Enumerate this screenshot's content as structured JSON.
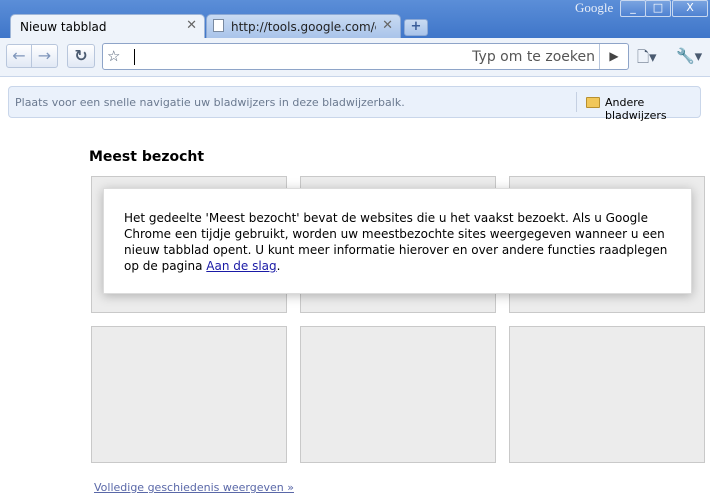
{
  "window": {
    "brand": "Google",
    "controls": {
      "minimize": "_",
      "maximize": "□",
      "close": "X"
    }
  },
  "tabs": [
    {
      "title": "Nieuw tabblad",
      "active": true
    },
    {
      "title": "http://tools.google.com/ch...",
      "active": false
    }
  ],
  "newtab_label": "+",
  "toolbar": {
    "back": "←",
    "forward": "→",
    "reload": "↻",
    "star": "☆",
    "omnibox_hint": "Typ om te zoeken",
    "go": "▶",
    "page_menu": "🗋▾",
    "tools_menu": "🔧▾"
  },
  "bookmarks": {
    "hint": "Plaats voor een snelle navigatie uw bladwijzers in deze bladwijzerbalk.",
    "other": "Andere bladwijzers"
  },
  "content": {
    "heading": "Meest bezocht",
    "info_text": "Het gedeelte 'Meest bezocht' bevat de websites die u het vaakst bezoekt. Als u Google Chrome een tijdje gebruikt, worden uw meestbezochte sites weergegeven wanneer u een nieuw tabblad opent. U kunt meer informatie hierover en over andere functies raadplegen op de pagina ",
    "info_link": "Aan de slag",
    "info_end": ".",
    "history_link": "Volledige geschiedenis weergeven »"
  }
}
